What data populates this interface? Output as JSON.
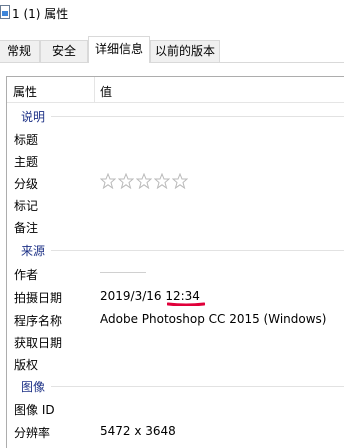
{
  "window": {
    "title": "1 (1) 属性",
    "icon": "image-file-icon"
  },
  "tabs": [
    {
      "label": "常规",
      "active": false
    },
    {
      "label": "安全",
      "active": false
    },
    {
      "label": "详细信息",
      "active": true
    },
    {
      "label": "以前的版本",
      "active": false
    }
  ],
  "columns": {
    "property": "属性",
    "value": "值"
  },
  "groups": {
    "description": "说明",
    "origin": "来源",
    "image": "图像"
  },
  "rows": {
    "title": {
      "label": "标题",
      "value": ""
    },
    "subject": {
      "label": "主题",
      "value": ""
    },
    "rating": {
      "label": "分级",
      "stars": 5,
      "filled": 0
    },
    "tags": {
      "label": "标记",
      "value": ""
    },
    "comments": {
      "label": "备注",
      "value": ""
    },
    "author": {
      "label": "作者",
      "value": ""
    },
    "date_taken": {
      "label": "拍摄日期",
      "value": "2019/3/16 12:34"
    },
    "program": {
      "label": "程序名称",
      "value": "Adobe Photoshop CC 2015 (Windows)"
    },
    "date_acquired": {
      "label": "获取日期",
      "value": ""
    },
    "copyright": {
      "label": "版权",
      "value": ""
    },
    "image_id": {
      "label": "图像 ID",
      "value": ""
    },
    "dimensions": {
      "label": "分辨率",
      "value": "5472 x 3648"
    }
  },
  "colors": {
    "group_text": "#1e3287",
    "annotation": "#e0003a",
    "star_outline": "#b9b9b9"
  }
}
